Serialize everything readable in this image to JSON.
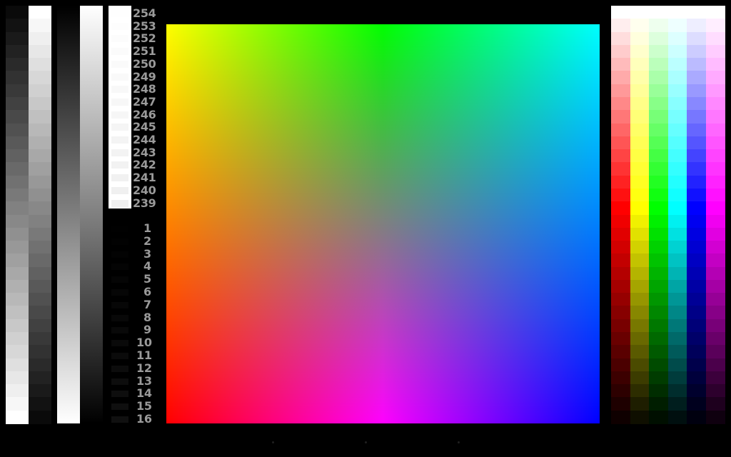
{
  "near_white_labels": [
    "254",
    "253",
    "252",
    "251",
    "250",
    "249",
    "248",
    "247",
    "246",
    "245",
    "244",
    "243",
    "242",
    "241",
    "240",
    "239"
  ],
  "near_black_labels": [
    "1",
    "2",
    "3",
    "4",
    "5",
    "6",
    "7",
    "8",
    "9",
    "10",
    "11",
    "12",
    "13",
    "14",
    "15",
    "16"
  ],
  "colors": {
    "background": "#000000",
    "label_gray": "#9a9a9a",
    "gamut_corners": {
      "top_left": "#ffff00",
      "top_center": "#00ff00",
      "top_right": "#00ffff",
      "bottom_left": "#ff0000",
      "bottom_center": "#ff00ff",
      "bottom_right": "#0000ff"
    }
  },
  "ramp_hues": [
    "#ff0000",
    "#ffff00",
    "#00ff00",
    "#00ffff",
    "#0000ff",
    "#ff00ff"
  ]
}
